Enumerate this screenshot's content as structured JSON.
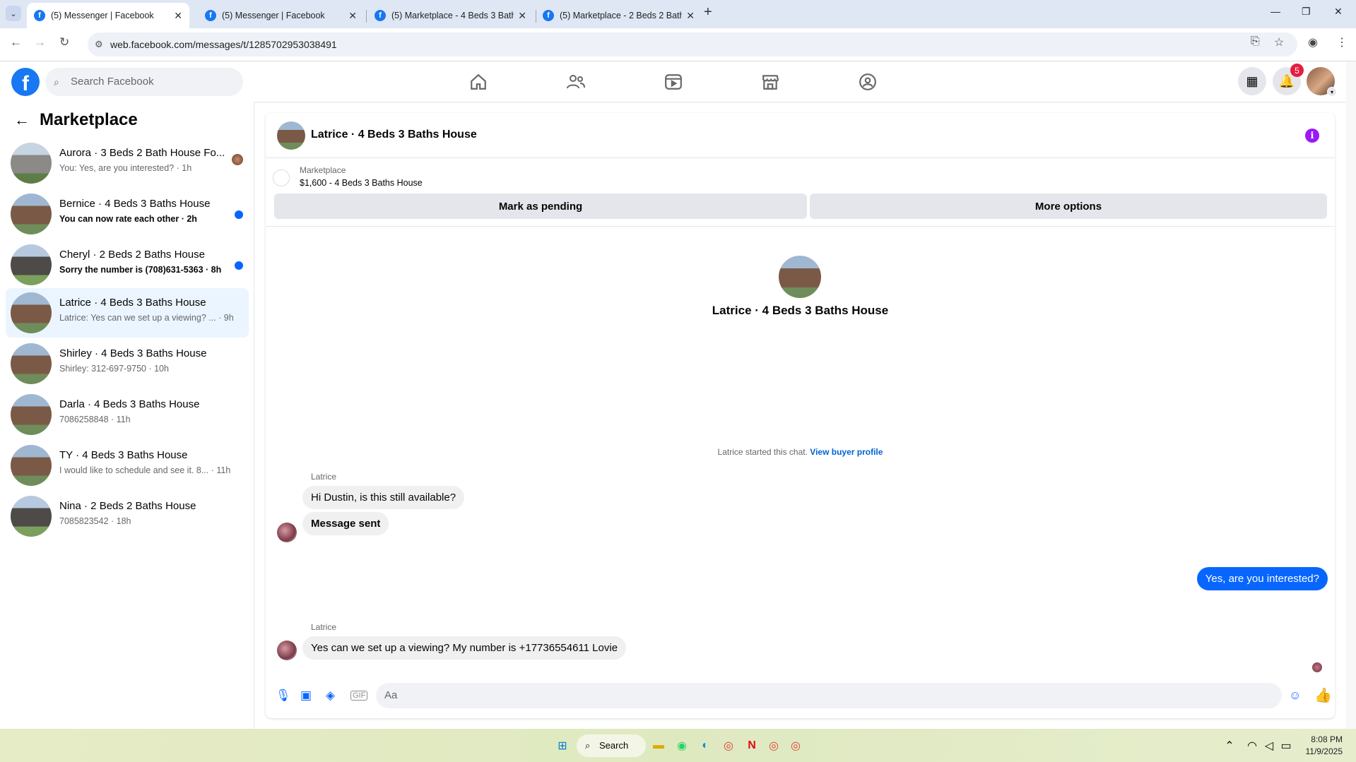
{
  "browser": {
    "tabs": [
      {
        "title": "(5) Messenger | Facebook",
        "active": true
      },
      {
        "title": "(5) Messenger | Facebook",
        "active": false
      },
      {
        "title": "(5) Marketplace - 4 Beds 3 Bath",
        "active": false
      },
      {
        "title": "(5) Marketplace - 2 Beds 2 Bath",
        "active": false
      }
    ],
    "url": "web.facebook.com/messages/t/1285702953038491"
  },
  "header": {
    "search_placeholder": "Search Facebook",
    "notification_count": "5"
  },
  "sidebar": {
    "title": "Marketplace",
    "conversations": [
      {
        "name": "Aurora · 3 Beds 2 Bath House Fo...",
        "preview": "You: Yes, are you interested? · 1h",
        "unread": false
      },
      {
        "name": "Bernice · 4 Beds 3 Baths House",
        "preview": "You can now rate each other · 2h",
        "unread": true
      },
      {
        "name": "Cheryl · 2 Beds 2 Baths House",
        "preview": "Sorry the number is (708)631-5363 · 8h",
        "unread": true
      },
      {
        "name": "Latrice · 4 Beds 3 Baths House",
        "preview": "Latrice: Yes can we set up a viewing? ... · 9h",
        "unread": false,
        "active": true
      },
      {
        "name": "Shirley · 4 Beds 3 Baths House",
        "preview": "Shirley: 312-697-9750 · 10h",
        "unread": false
      },
      {
        "name": "Darla · 4 Beds 3 Baths House",
        "preview": "7086258848 · 11h",
        "unread": false
      },
      {
        "name": "TY · 4 Beds 3 Baths House",
        "preview": "I would like to schedule and see it. 8... · 11h",
        "unread": false
      },
      {
        "name": "Nina · 2 Beds 2 Baths House",
        "preview": "7085823542 · 18h",
        "unread": false
      }
    ]
  },
  "chat": {
    "title": "Latrice · 4 Beds 3 Baths House",
    "marketplace_label": "Marketplace",
    "listing": "$1,600 - 4 Beds 3 Baths House",
    "mark_pending": "Mark as pending",
    "more_options": "More options",
    "started_text": "Latrice started this chat.",
    "view_profile": "View buyer profile",
    "messages": [
      {
        "sender": "Latrice",
        "text": "Hi Dustin, is this still available?"
      },
      {
        "text": "Message sent"
      },
      {
        "text": "Yes, are you interested?",
        "outgoing": true
      },
      {
        "sender": "Latrice",
        "text": "Yes can we set up a viewing? My number is +17736554611 Lovie"
      }
    ],
    "composer_placeholder": "Aa"
  },
  "taskbar": {
    "search_label": "Search",
    "time": "8:08 PM",
    "date": "11/9/2025"
  }
}
